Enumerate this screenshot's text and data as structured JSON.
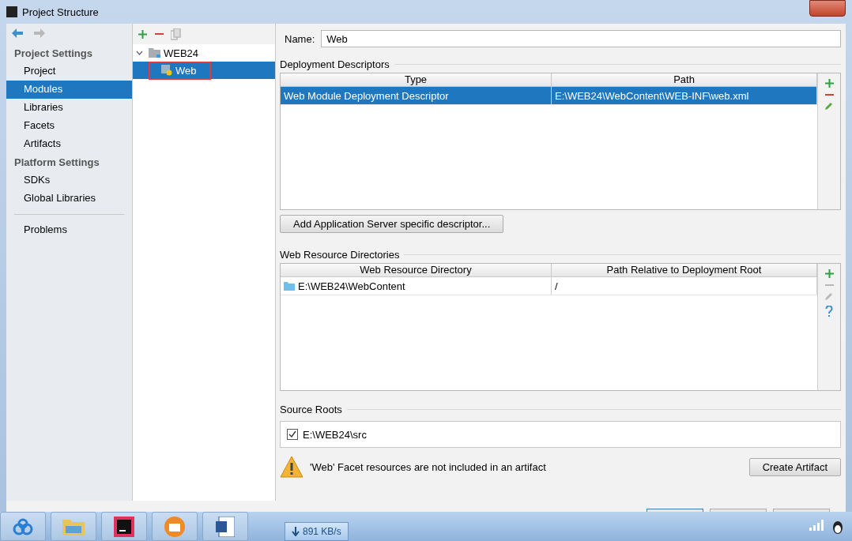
{
  "window": {
    "title": "Project Structure"
  },
  "sidebar": {
    "sections": [
      {
        "heading": "Project Settings",
        "items": [
          {
            "label": "Project",
            "selected": false
          },
          {
            "label": "Modules",
            "selected": true
          },
          {
            "label": "Libraries",
            "selected": false
          },
          {
            "label": "Facets",
            "selected": false
          },
          {
            "label": "Artifacts",
            "selected": false
          }
        ]
      },
      {
        "heading": "Platform Settings",
        "items": [
          {
            "label": "SDKs",
            "selected": false
          },
          {
            "label": "Global Libraries",
            "selected": false
          }
        ]
      }
    ],
    "extra_items": [
      {
        "label": "Problems",
        "selected": false
      }
    ]
  },
  "module_tree": {
    "items": [
      {
        "label": "WEB24",
        "expanded": true,
        "selected": false,
        "highlighted": false,
        "children": [
          {
            "label": "Web",
            "selected": true,
            "highlighted": true
          }
        ]
      }
    ]
  },
  "name_field": {
    "label": "Name:",
    "value": "Web"
  },
  "deployment_descriptors": {
    "title": "Deployment Descriptors",
    "columns": [
      "Type",
      "Path"
    ],
    "rows": [
      {
        "cells": [
          "Web Module Deployment Descriptor",
          "E:\\WEB24\\WebContent\\WEB-INF\\web.xml"
        ],
        "selected": true
      }
    ],
    "tools": [
      {
        "kind": "add",
        "disabled": false
      },
      {
        "kind": "remove",
        "disabled": false
      },
      {
        "kind": "edit",
        "disabled": false
      }
    ],
    "button": "Add Application Server specific descriptor..."
  },
  "web_resource_directories": {
    "title": "Web Resource Directories",
    "columns": [
      "Web Resource Directory",
      "Path Relative to Deployment Root"
    ],
    "rows": [
      {
        "cells": [
          "E:\\WEB24\\WebContent",
          "/"
        ],
        "selected": false,
        "kind": "folder"
      }
    ],
    "tools": [
      {
        "kind": "add",
        "disabled": false
      },
      {
        "kind": "remove",
        "disabled": true
      },
      {
        "kind": "edit",
        "disabled": true
      },
      {
        "kind": "help",
        "disabled": false
      }
    ]
  },
  "source_roots": {
    "title": "Source Roots",
    "items": [
      {
        "label": "E:\\WEB24\\src",
        "checked": true
      }
    ]
  },
  "warning": {
    "text": "'Web' Facet resources are not included in an artifact",
    "button": "Create Artifact"
  },
  "taskbar": {
    "speed": "891 KB/s"
  }
}
